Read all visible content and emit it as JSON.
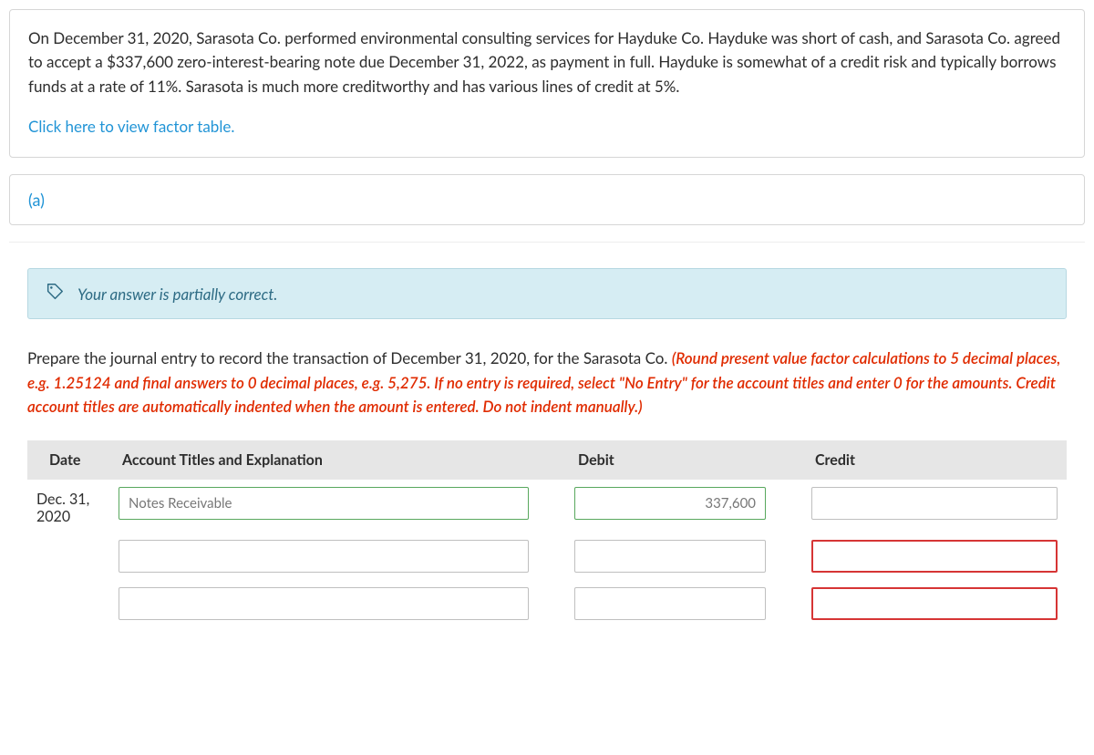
{
  "intro": {
    "problem_text": "On December 31, 2020, Sarasota Co. performed environmental consulting services for Hayduke Co. Hayduke was short of cash, and Sarasota Co. agreed to accept a $337,600 zero-interest-bearing note due December 31, 2022, as payment in full. Hayduke is somewhat of a credit risk and typically borrows funds at a rate of 11%. Sarasota is much more creditworthy and has various lines of credit at 5%.",
    "factor_link": "Click here to view factor table."
  },
  "part": {
    "label": "(a)"
  },
  "feedback": {
    "message": "Your answer is partially correct."
  },
  "instructions": {
    "lead": "Prepare the journal entry to record the transaction of December 31, 2020, for the Sarasota Co. ",
    "note": "(Round present value factor calculations to 5 decimal places, e.g. 1.25124 and final answers to 0 decimal places, e.g. 5,275. If no entry is required, select \"No Entry\" for the account titles and enter 0 for the amounts. Credit account titles are automatically indented when the amount is entered. Do not indent manually.)"
  },
  "table": {
    "headers": {
      "date": "Date",
      "account": "Account Titles and Explanation",
      "debit": "Debit",
      "credit": "Credit"
    },
    "rows": [
      {
        "date": "Dec. 31, 2020",
        "account_value": "Notes Receivable",
        "account_state": "green",
        "debit_value": "337,600",
        "debit_state": "green",
        "credit_value": "",
        "credit_state": "plain"
      },
      {
        "date": "",
        "account_value": "",
        "account_state": "plain",
        "debit_value": "",
        "debit_state": "plain",
        "credit_value": "",
        "credit_state": "red"
      },
      {
        "date": "",
        "account_value": "",
        "account_state": "plain",
        "debit_value": "",
        "debit_state": "plain",
        "credit_value": "",
        "credit_state": "red"
      }
    ]
  }
}
